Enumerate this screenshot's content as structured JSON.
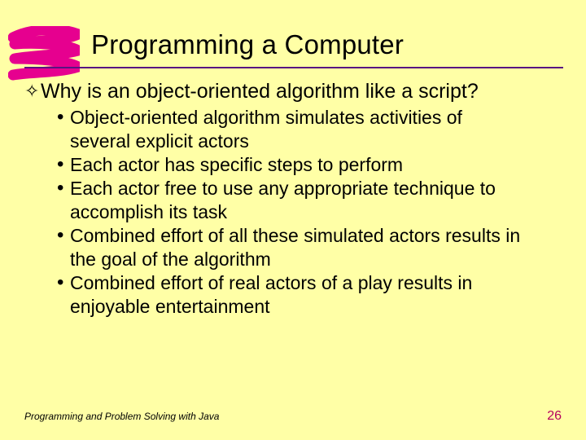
{
  "title": "Programming a Computer",
  "question": "Why is an object-oriented algorithm like a script?",
  "bullets": [
    "Object-oriented algorithm simulates activities of several explicit actors",
    "Each actor has specific steps to perform",
    "Each actor free to use any appropriate technique to accomplish its task",
    "Combined effort of all these simulated actors results in the goal of the algorithm",
    "Combined effort of real actors of a play results in enjoyable entertainment"
  ],
  "footer": {
    "left": "Programming and Problem Solving with Java",
    "page": "26"
  },
  "colors": {
    "accent": "#581481",
    "brush": "#e6008f"
  }
}
